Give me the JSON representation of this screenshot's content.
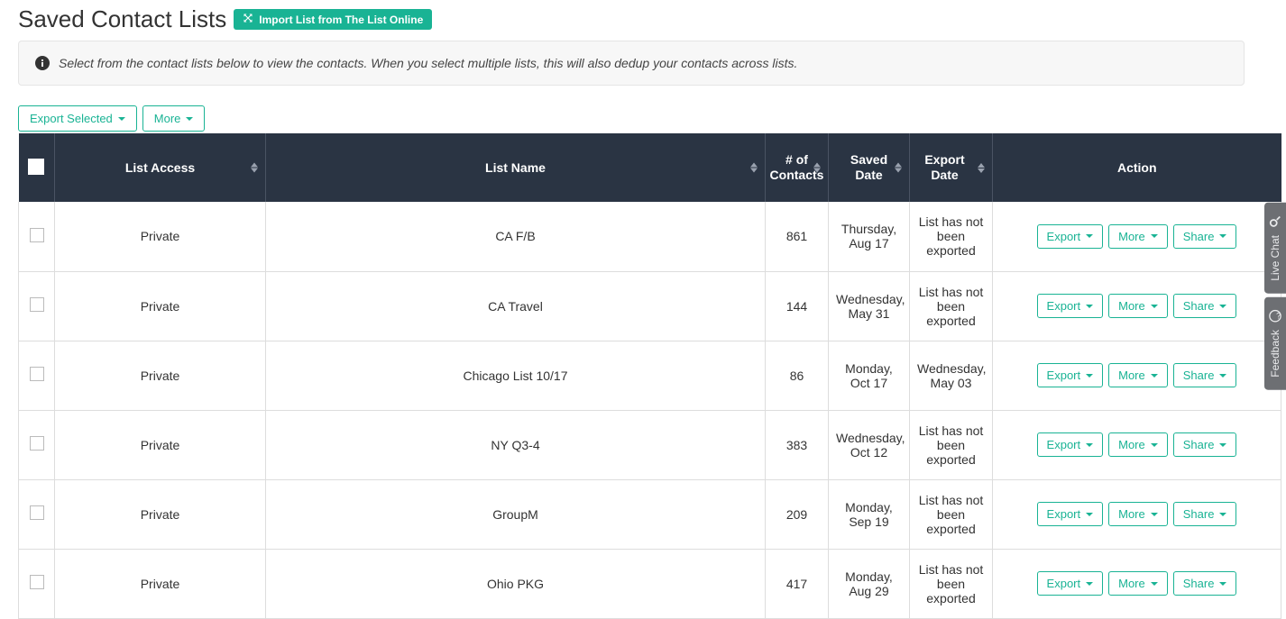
{
  "header": {
    "title": "Saved Contact Lists",
    "import_label": "Import List from The List Online"
  },
  "alert": {
    "text": "Select from the contact lists below to view the contacts. When you select multiple lists, this will also dedup your contacts across lists."
  },
  "toolbar": {
    "export_selected_label": "Export Selected",
    "more_label": "More"
  },
  "columns": {
    "access": "List Access",
    "name": "List Name",
    "count": "# of Contacts",
    "saved": "Saved Date",
    "export": "Export Date",
    "action": "Action"
  },
  "action_labels": {
    "export": "Export",
    "more": "More",
    "share": "Share"
  },
  "rows": [
    {
      "access": "Private",
      "name": "CA F/B",
      "count": "861",
      "saved": "Thursday, Aug 17",
      "export": "List has not been exported"
    },
    {
      "access": "Private",
      "name": "CA Travel",
      "count": "144",
      "saved": "Wednesday, May 31",
      "export": "List has not been exported"
    },
    {
      "access": "Private",
      "name": "Chicago List 10/17",
      "count": "86",
      "saved": "Monday, Oct 17",
      "export": "Wednesday, May 03"
    },
    {
      "access": "Private",
      "name": "NY Q3-4",
      "count": "383",
      "saved": "Wednesday, Oct 12",
      "export": "List has not been exported"
    },
    {
      "access": "Private",
      "name": "GroupM",
      "count": "209",
      "saved": "Monday, Sep 19",
      "export": "List has not been exported"
    },
    {
      "access": "Private",
      "name": "Ohio PKG",
      "count": "417",
      "saved": "Monday, Aug 29",
      "export": "List has not been exported"
    }
  ],
  "side": {
    "live_chat": "Live Chat",
    "feedback": "Feedback"
  }
}
